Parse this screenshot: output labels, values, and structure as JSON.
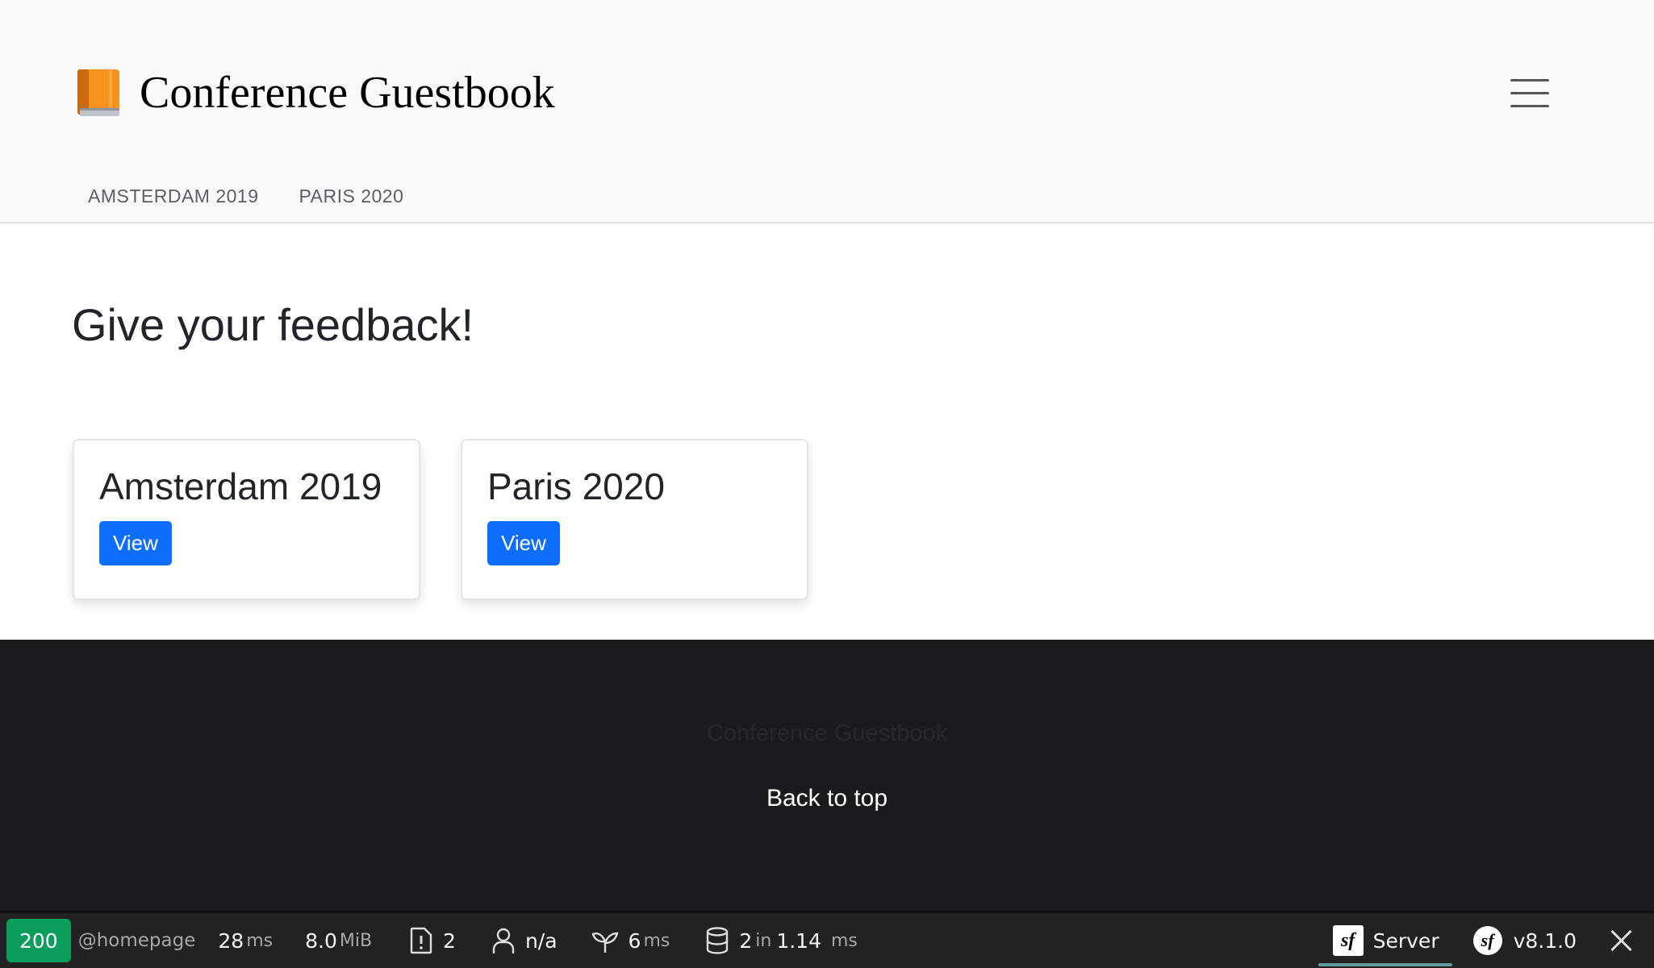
{
  "header": {
    "brand_title": "Conference Guestbook",
    "brand_icon": "orange-book-icon",
    "menu_icon": "hamburger-icon",
    "nav": [
      {
        "label": "AMSTERDAM 2019"
      },
      {
        "label": "PARIS 2020"
      }
    ]
  },
  "main": {
    "title": "Give your feedback!",
    "cards": [
      {
        "title": "Amsterdam 2019",
        "button": "View"
      },
      {
        "title": "Paris 2020",
        "button": "View"
      }
    ]
  },
  "footer": {
    "brand": "Conference Guestbook",
    "back_to_top": "Back to top"
  },
  "toolbar": {
    "status_code": "200",
    "route": "@homepage",
    "time_value": "28",
    "time_unit": "ms",
    "memory_value": "8.0",
    "memory_unit": "MiB",
    "logs_count": "2",
    "user": "n/a",
    "twig_value": "6",
    "twig_unit": "ms",
    "db_queries": "2",
    "db_in": "in",
    "db_time": "1.14",
    "db_unit": "ms",
    "server_label": "Server",
    "version": "v8.1.0",
    "colors": {
      "status_ok": "#0a9d5c",
      "background": "#222222"
    }
  }
}
